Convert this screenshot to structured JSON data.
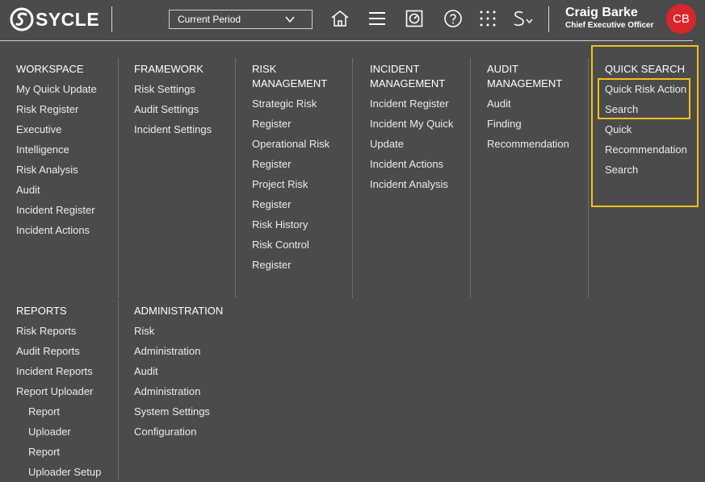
{
  "header": {
    "logo_text": "SYCLE",
    "period_label": "Current Period",
    "icons": [
      "home-icon",
      "hamburger-menu-icon",
      "dashboard-icon",
      "help-icon",
      "app-grid-icon",
      "switcher-icon"
    ],
    "user": {
      "name": "Craig Barke",
      "role": "Chief Executive Officer",
      "initials": "CB",
      "avatar_color": "#d9262b"
    }
  },
  "menu": {
    "workspace": {
      "heading": "WORKSPACE",
      "items": [
        "My Quick Update",
        "Risk Register",
        "Executive",
        "Intelligence",
        "Risk Analysis",
        "Audit",
        "Incident Register",
        "Incident Actions"
      ]
    },
    "framework": {
      "heading": "FRAMEWORK",
      "items": [
        "Risk Settings",
        "Audit Settings",
        "Incident Settings"
      ]
    },
    "risk_management": {
      "heading_line1": "RISK",
      "heading_line2": "MANAGEMENT",
      "items": [
        "Strategic Risk",
        "Register",
        "Operational Risk",
        "Register",
        "Project Risk",
        "Register",
        "Risk History",
        "Risk Control",
        "Register"
      ]
    },
    "incident_management": {
      "heading_line1": "INCIDENT",
      "heading_line2": "MANAGEMENT",
      "items": [
        "Incident Register",
        "Incident My Quick",
        "Update",
        "Incident Actions",
        "Incident Analysis"
      ]
    },
    "audit_management": {
      "heading_line1": "AUDIT",
      "heading_line2": "MANAGEMENT",
      "items": [
        "Audit",
        "Finding",
        "Recommendation"
      ]
    },
    "quick_search": {
      "heading": "QUICK SEARCH",
      "items": [
        "Quick Risk Action",
        "Search",
        "Quick",
        "Recommendation",
        "Search"
      ]
    },
    "reports": {
      "heading": "REPORTS",
      "items": [
        "Risk Reports",
        "Audit Reports",
        "Incident Reports",
        "Report Uploader"
      ],
      "sub_items": [
        "Report",
        "Uploader",
        "Report",
        "Uploader Setup"
      ]
    },
    "administration": {
      "heading": "ADMINISTRATION",
      "items": [
        "Risk",
        "Administration",
        "Audit",
        "Administration",
        "System Settings",
        "Configuration"
      ]
    }
  },
  "colors": {
    "background": "#4b4b4b",
    "highlight": "#f1c21b",
    "text": "#ffffff"
  }
}
